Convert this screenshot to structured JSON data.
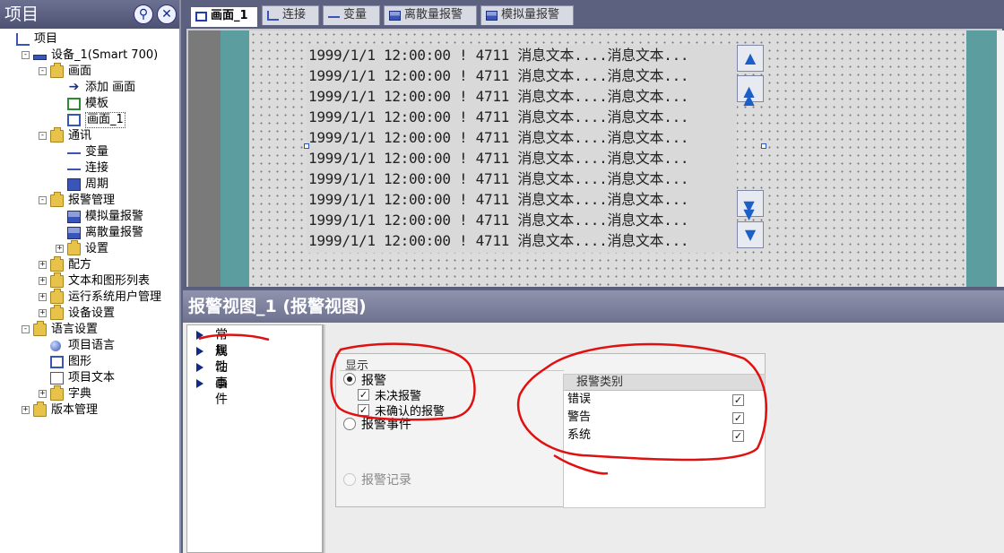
{
  "project_panel": {
    "title": "项目",
    "tree": [
      {
        "label": "项目",
        "level": 0,
        "icon": "chart-icon"
      },
      {
        "label": "设备_1(Smart 700)",
        "level": 1,
        "icon": "device-icon",
        "expander": "-"
      },
      {
        "label": "画面",
        "level": 2,
        "icon": "folder-icon",
        "expander": "-"
      },
      {
        "label": "添加 画面",
        "level": 3,
        "icon": "add-screen-icon"
      },
      {
        "label": "模板",
        "level": 3,
        "icon": "template-icon"
      },
      {
        "label": "画面_1",
        "level": 3,
        "icon": "screen-icon",
        "selected": true
      },
      {
        "label": "通讯",
        "level": 2,
        "icon": "folder-icon",
        "expander": "-"
      },
      {
        "label": "变量",
        "level": 3,
        "icon": "tag-icon"
      },
      {
        "label": "连接",
        "level": 3,
        "icon": "connection-icon"
      },
      {
        "label": "周期",
        "level": 3,
        "icon": "cycle-icon"
      },
      {
        "label": "报警管理",
        "level": 2,
        "icon": "folder-icon",
        "expander": "-"
      },
      {
        "label": "模拟量报警",
        "level": 3,
        "icon": "alarm-icon"
      },
      {
        "label": "离散量报警",
        "level": 3,
        "icon": "alarm-icon"
      },
      {
        "label": "设置",
        "level": 3,
        "icon": "folder-icon",
        "expander": "+"
      },
      {
        "label": "配方",
        "level": 2,
        "icon": "folder-icon",
        "expander": "+"
      },
      {
        "label": "文本和图形列表",
        "level": 2,
        "icon": "folder-icon",
        "expander": "+"
      },
      {
        "label": "运行系统用户管理",
        "level": 2,
        "icon": "folder-icon",
        "expander": "+"
      },
      {
        "label": "设备设置",
        "level": 2,
        "icon": "folder-icon",
        "expander": "+"
      },
      {
        "label": "语言设置",
        "level": 1,
        "icon": "folder-icon",
        "expander": "-"
      },
      {
        "label": "项目语言",
        "level": 2,
        "icon": "globe-icon"
      },
      {
        "label": "图形",
        "level": 2,
        "icon": "graphic-icon"
      },
      {
        "label": "项目文本",
        "level": 2,
        "icon": "text-icon"
      },
      {
        "label": "字典",
        "level": 2,
        "icon": "folder-icon",
        "expander": "+"
      },
      {
        "label": "版本管理",
        "level": 1,
        "icon": "folder-icon",
        "expander": "+"
      }
    ]
  },
  "tabs": [
    {
      "label": "画面_1",
      "icon": "screen-icon",
      "active": true
    },
    {
      "label": "连接",
      "icon": "connection-icon"
    },
    {
      "label": "变量",
      "icon": "tag-icon"
    },
    {
      "label": "离散量报警",
      "icon": "alarm-icon"
    },
    {
      "label": "模拟量报警",
      "icon": "alarm-icon"
    }
  ],
  "alarm_view": {
    "rows": [
      "1999/1/1 12:00:00 ! 4711 消息文本....消息文本...",
      "1999/1/1 12:00:00 ! 4711 消息文本....消息文本...",
      "1999/1/1 12:00:00 ! 4711 消息文本....消息文本...",
      "1999/1/1 12:00:00 ! 4711 消息文本....消息文本...",
      "1999/1/1 12:00:00 ! 4711 消息文本....消息文本...",
      "1999/1/1 12:00:00 ! 4711 消息文本....消息文本...",
      "1999/1/1 12:00:00 ! 4711 消息文本....消息文本...",
      "1999/1/1 12:00:00 ! 4711 消息文本....消息文本...",
      "1999/1/1 12:00:00 ! 4711 消息文本....消息文本...",
      "1999/1/1 12:00:00 ! 4711 消息文本....消息文本..."
    ],
    "buttons": [
      "▲",
      "▲▲",
      "▼▼",
      "▼"
    ]
  },
  "properties": {
    "title": "报警视图_1 (报警视图)",
    "nav": [
      "常规",
      "属性",
      "动画",
      "事件"
    ],
    "display": {
      "legend": "显示",
      "alarms_label": "报警",
      "unacked_label": "未决报警",
      "unconfirmed_label": "未确认的报警",
      "events_label": "报警事件",
      "log_label": "报警记录"
    },
    "categories": {
      "header": "报警类别",
      "items": [
        {
          "label": "错误",
          "checked": true
        },
        {
          "label": "警告",
          "checked": true
        },
        {
          "label": "系统",
          "checked": true
        }
      ]
    }
  },
  "colors": {
    "frame": "#5d6180",
    "teal": "#5c9ea0",
    "annotation_red": "#e01010"
  }
}
